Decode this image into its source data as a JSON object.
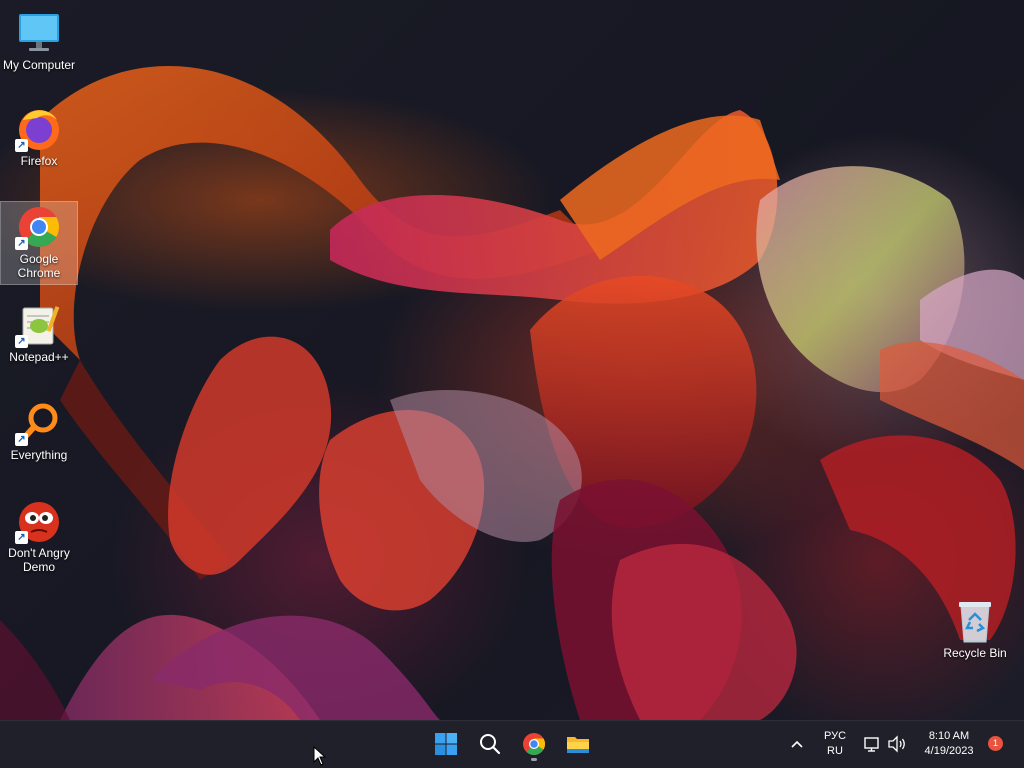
{
  "desktop": {
    "icons": [
      {
        "label": "My Computer"
      },
      {
        "label": "Firefox"
      },
      {
        "label": "Google Chrome"
      },
      {
        "label": "Notepad++"
      },
      {
        "label": "Everything"
      },
      {
        "label": "Don't Angry Demo"
      },
      {
        "label": "Recycle Bin"
      }
    ]
  },
  "taskbar": {
    "apps": [
      {
        "icon": "windows-start-icon"
      },
      {
        "icon": "search-icon"
      },
      {
        "icon": "chrome-icon"
      },
      {
        "icon": "file-explorer-icon"
      }
    ],
    "tray": {
      "language_top": "РУС",
      "language_bottom": "RU",
      "time": "8:10 AM",
      "date": "4/19/2023",
      "notification_count": "1"
    }
  },
  "colors": {
    "taskbar": "#1f2029",
    "accent": "#0078d4",
    "badge": "#e8543f"
  }
}
